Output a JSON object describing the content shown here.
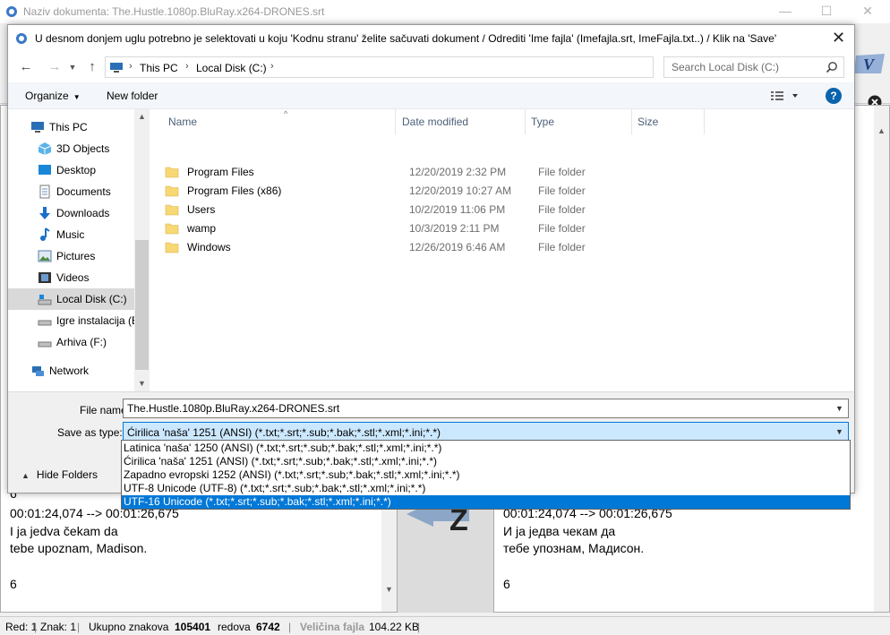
{
  "app": {
    "title": "Naziv dokumenta: The.Hustle.1080p.BluRay.x264-DRONES.srt",
    "min_label": "—",
    "max_label": "☐",
    "close_label": "✕"
  },
  "left_pane": {
    "lines": [
      "6",
      "00:01:24,074 --> 00:01:26,675",
      "I ja jedva čekam da",
      "tebe upoznam, Madison.",
      "",
      "6"
    ]
  },
  "right_pane": {
    "lines": [
      "6",
      "00:01:24,074 --> 00:01:26,675",
      "И ја једва чекам да",
      "тебе упознам, Мадисон.",
      "",
      "6"
    ]
  },
  "statusbar": {
    "red_label": "Red: 1",
    "znak_label": "Znak: 1",
    "ukupno_label": "Ukupno znakova",
    "ukupno_value": "105401",
    "redova_label": "redova",
    "redova_value": "6742",
    "velicina_label": "Veličina fajla",
    "velicina_value": "104.22 KB"
  },
  "dialog": {
    "title": "U desnom donjem uglu potrebno je selektovati u koju 'Kodnu stranu' želite sačuvati dokument / Odrediti 'Ime fajla' (Imefajla.srt, ImeFajla.txt..) / Klik na 'Save'",
    "close_label": "✕",
    "breadcrumb": [
      "This PC",
      "Local Disk (C:)"
    ],
    "search_placeholder": "Search Local Disk (C:)",
    "organize_label": "Organize",
    "new_folder_label": "New folder",
    "help_label": "?",
    "nav_items": [
      {
        "label": "This PC"
      },
      {
        "label": "3D Objects"
      },
      {
        "label": "Desktop"
      },
      {
        "label": "Documents"
      },
      {
        "label": "Downloads"
      },
      {
        "label": "Music"
      },
      {
        "label": "Pictures"
      },
      {
        "label": "Videos"
      },
      {
        "label": "Local Disk (C:)"
      },
      {
        "label": "Igre instalacija (E:)"
      },
      {
        "label": "Arhiva (F:)"
      },
      {
        "label": "Network"
      }
    ],
    "columns": {
      "name": "Name",
      "date": "Date modified",
      "type": "Type",
      "size": "Size"
    },
    "files": [
      {
        "name": "Program Files",
        "date": "12/20/2019 2:32 PM",
        "type": "File folder"
      },
      {
        "name": "Program Files (x86)",
        "date": "12/20/2019 10:27 AM",
        "type": "File folder"
      },
      {
        "name": "Users",
        "date": "10/2/2019 11:06 PM",
        "type": "File folder"
      },
      {
        "name": "wamp",
        "date": "10/3/2019 2:11 PM",
        "type": "File folder"
      },
      {
        "name": "Windows",
        "date": "12/26/2019 6:46 AM",
        "type": "File folder"
      }
    ],
    "file_name_label": "File name:",
    "file_name_value": "The.Hustle.1080p.BluRay.x264-DRONES.srt",
    "save_type_label": "Save as type:",
    "save_type_value": "Ćirilica 'naša' 1251 (ANSI) (*.txt;*.srt;*.sub;*.bak;*.stl;*.xml;*.ini;*.*)",
    "hide_folders_label": "Hide Folders",
    "type_options": [
      "Latinica 'naša' 1250 (ANSI) (*.txt;*.srt;*.sub;*.bak;*.stl;*.xml;*.ini;*.*)",
      "Ćirilica 'naša' 1251 (ANSI) (*.txt;*.srt;*.sub;*.bak;*.stl;*.xml;*.ini;*.*)",
      "Zapadno evropski 1252 (ANSI) (*.txt;*.srt;*.sub;*.bak;*.stl;*.xml;*.ini;*.*)",
      "UTF-8 Unicode (UTF-8) (*.txt;*.srt;*.sub;*.bak;*.stl;*.xml;*.ini;*.*)",
      "UTF-16 Unicode (*.txt;*.srt;*.sub;*.bak;*.stl;*.xml;*.ini;*.*)"
    ],
    "selected_option_index": 4
  },
  "colors": {
    "accent": "#0078d7",
    "selection_bg": "#cce8ff",
    "folder": "#f8d775",
    "header_text": "#4c607a"
  },
  "icons": {
    "app": "app-logo-icon",
    "nav_back": "arrow-left-icon",
    "nav_forward": "arrow-right-icon",
    "nav_up": "arrow-up-icon",
    "refresh": "refresh-icon",
    "search": "search-icon",
    "folder": "folder-icon"
  }
}
